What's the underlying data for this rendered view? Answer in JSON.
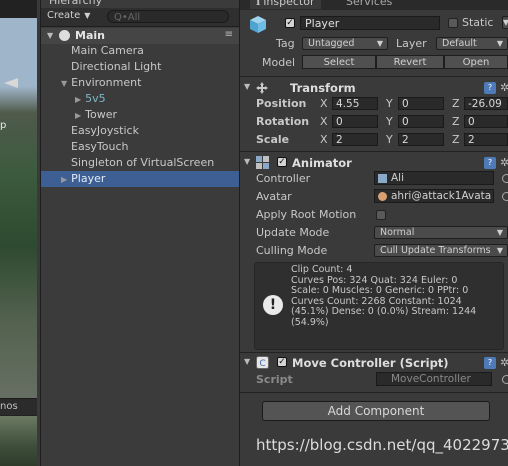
{
  "scene_view": {
    "side_label": "p",
    "bottom_tab": "nos"
  },
  "hierarchy": {
    "tab": "Hierarchy",
    "create": "Create",
    "search_placeholder": "Q•All",
    "scene_name": "Main",
    "items": [
      {
        "label": "Main Camera"
      },
      {
        "label": "Directional Light"
      },
      {
        "label": "Environment"
      },
      {
        "label": "5v5"
      },
      {
        "label": "Tower"
      },
      {
        "label": "EasyJoystick"
      },
      {
        "label": "EasyTouch"
      },
      {
        "label": "Singleton of VirtualScreen"
      },
      {
        "label": "Player"
      }
    ]
  },
  "inspector": {
    "tab_inspector": "Inspector",
    "tab_services": "Services",
    "object_name": "Player",
    "static_label": "Static",
    "tag_label": "Tag",
    "tag_value": "Untagged",
    "layer_label": "Layer",
    "layer_value": "Default",
    "model_label": "Model",
    "model_buttons": [
      "Select",
      "Revert",
      "Open"
    ],
    "transform": {
      "title": "Transform",
      "position_label": "Position",
      "rotation_label": "Rotation",
      "scale_label": "Scale",
      "axis": [
        "X",
        "Y",
        "Z"
      ],
      "position": [
        "4.55",
        "0",
        "-26.09"
      ],
      "rotation": [
        "0",
        "0",
        "0"
      ],
      "scale": [
        "2",
        "2",
        "2"
      ]
    },
    "animator": {
      "title": "Animator",
      "controller_label": "Controller",
      "controller_value": "Ali",
      "avatar_label": "Avatar",
      "avatar_value": "ahri@attack1Avata",
      "apply_root_motion_label": "Apply Root Motion",
      "update_mode_label": "Update Mode",
      "update_mode_value": "Normal",
      "culling_mode_label": "Culling Mode",
      "culling_mode_value": "Cull Update Transforms",
      "info": "Clip Count: 4\nCurves Pos: 324 Quat: 324 Euler: 0\nScale: 0 Muscles: 0 Generic: 0 PPtr: 0\nCurves Count: 2268 Constant: 1024\n(45.1%) Dense: 0 (0.0%) Stream: 1244\n(54.9%)"
    },
    "move_controller": {
      "title": "Move Controller (Script)",
      "script_label": "Script",
      "script_value": "MoveController"
    },
    "add_component": "Add Component"
  },
  "watermark": "https://blog.csdn.net/qq_40229737",
  "colors": {
    "selection": "#3d5f94",
    "teal_prefab": "#7fb6c8",
    "panel_bg": "#3a3a3a"
  }
}
